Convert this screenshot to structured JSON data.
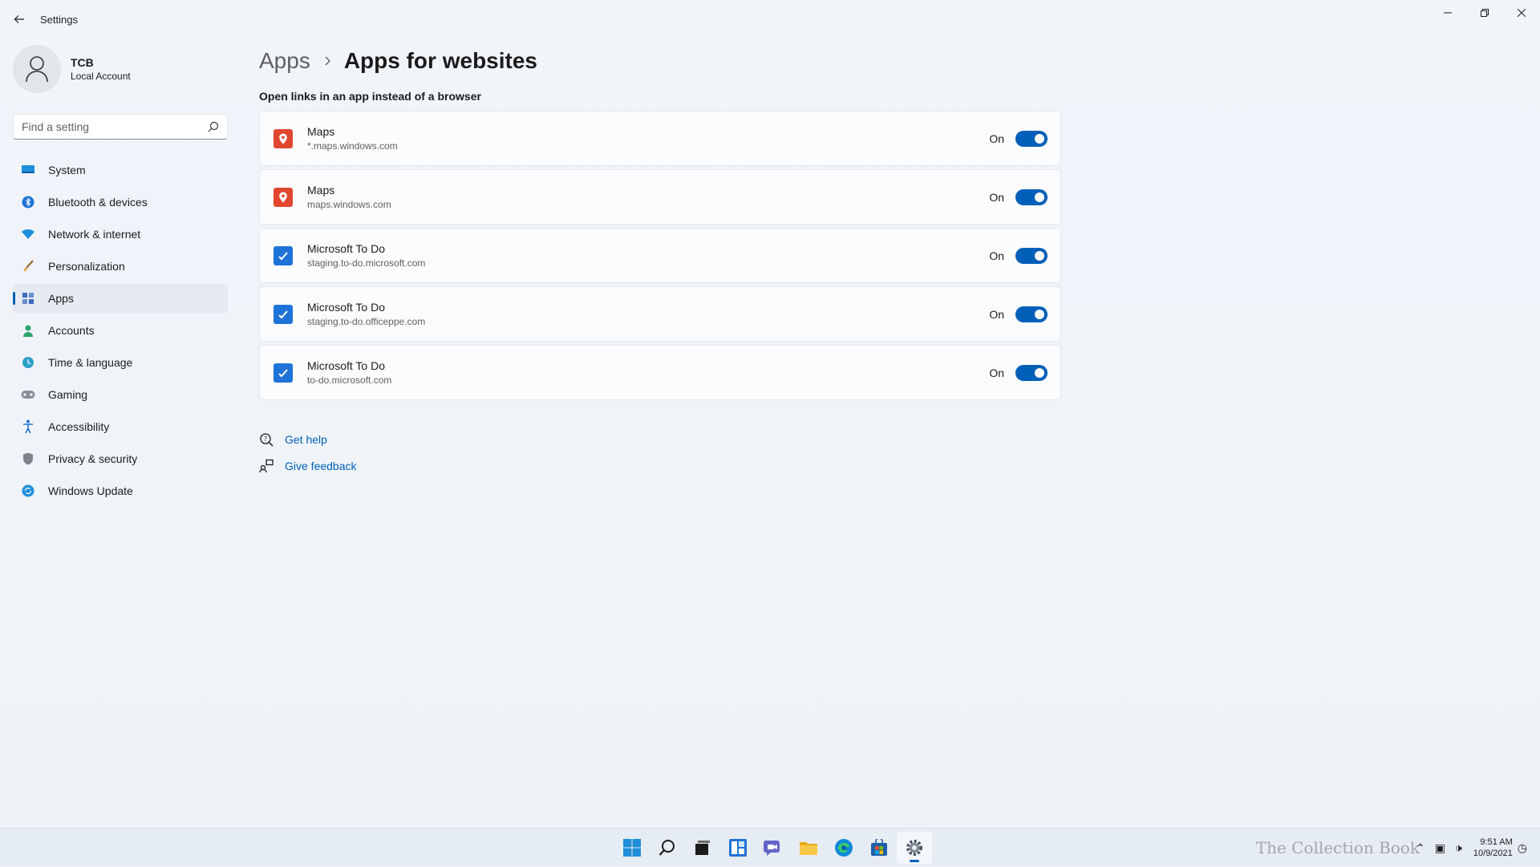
{
  "window": {
    "title": "Settings",
    "back_icon": "back-arrow-icon",
    "controls": [
      "minimize-icon",
      "restore-icon",
      "close-icon"
    ]
  },
  "profile": {
    "name": "TCB",
    "account_type": "Local Account"
  },
  "search": {
    "placeholder": "Find a setting"
  },
  "sidebar": {
    "items": [
      {
        "label": "System",
        "icon": "system-icon"
      },
      {
        "label": "Bluetooth & devices",
        "icon": "bluetooth-icon"
      },
      {
        "label": "Network & internet",
        "icon": "network-icon"
      },
      {
        "label": "Personalization",
        "icon": "brush-icon"
      },
      {
        "label": "Apps",
        "icon": "apps-icon",
        "active": true
      },
      {
        "label": "Accounts",
        "icon": "accounts-icon"
      },
      {
        "label": "Time & language",
        "icon": "time-language-icon"
      },
      {
        "label": "Gaming",
        "icon": "gaming-icon"
      },
      {
        "label": "Accessibility",
        "icon": "accessibility-icon"
      },
      {
        "label": "Privacy & security",
        "icon": "shield-icon"
      },
      {
        "label": "Windows Update",
        "icon": "update-icon"
      }
    ]
  },
  "breadcrumb": {
    "parent": "Apps",
    "current": "Apps for websites"
  },
  "main": {
    "section_label": "Open links in an app instead of a browser",
    "apps": [
      {
        "name": "Maps",
        "domain": "*.maps.windows.com",
        "state": "On",
        "icon": "maps-icon"
      },
      {
        "name": "Maps",
        "domain": "maps.windows.com",
        "state": "On",
        "icon": "maps-icon"
      },
      {
        "name": "Microsoft To Do",
        "domain": "staging.to-do.microsoft.com",
        "state": "On",
        "icon": "todo-icon"
      },
      {
        "name": "Microsoft To Do",
        "domain": "staging.to-do.officeppe.com",
        "state": "On",
        "icon": "todo-icon"
      },
      {
        "name": "Microsoft To Do",
        "domain": "to-do.microsoft.com",
        "state": "On",
        "icon": "todo-icon"
      }
    ],
    "help": {
      "get_help": "Get help",
      "give_feedback": "Give feedback"
    }
  },
  "taskbar": {
    "apps": [
      "start-icon",
      "search-icon",
      "task-view-icon",
      "widgets-icon",
      "chat-icon",
      "file-explorer-icon",
      "edge-icon",
      "store-icon",
      "settings-icon"
    ],
    "active": "settings-icon",
    "time": "9:51 AM",
    "date": "10/9/2021",
    "watermark": "The Collection Book"
  },
  "colors": {
    "accent": "#005fb8",
    "maps": "#e0472e",
    "todo": "#1e73d8"
  }
}
